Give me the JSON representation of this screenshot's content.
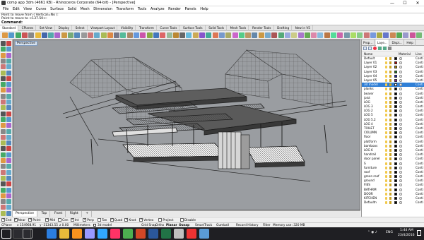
{
  "window": {
    "title": "comp app 3dm (4661 KB) - Rhinoceros Corporate (64-bit) - [Perspective]",
    "minimize": "—",
    "maximize": "☐",
    "close": "✕"
  },
  "menu": [
    "File",
    "Edit",
    "View",
    "Curve",
    "Surface",
    "Solid",
    "Mesh",
    "Dimension",
    "Transform",
    "Tools",
    "Analyze",
    "Render",
    "Panels",
    "Help"
  ],
  "command": {
    "history": [
      "Point to move from ( Vertical=No ):",
      "Point to move to <137.50>:"
    ],
    "prompt": "Command:"
  },
  "toolbar_tabs": [
    "Standard",
    "CPlanes",
    "Set View",
    "Display",
    "Select",
    "Viewport Layout",
    "Visibility",
    "Transform",
    "Curve Tools",
    "Surface Tools",
    "Solid Tools",
    "Mesh Tools",
    "Render Tools",
    "Drafting",
    "New in V5"
  ],
  "toolbar_tabs_active": 0,
  "viewport": {
    "label": "Perspective"
  },
  "view_tabs": [
    "Perspective",
    "Top",
    "Front",
    "Right",
    "+"
  ],
  "view_tabs_active": 0,
  "osnaps": [
    {
      "label": "End",
      "on": true
    },
    {
      "label": "Near",
      "on": true
    },
    {
      "label": "Point",
      "on": true
    },
    {
      "label": "Mid",
      "on": true
    },
    {
      "label": "Cen",
      "on": false
    },
    {
      "label": "Int",
      "on": true
    },
    {
      "label": "Perp",
      "on": true
    },
    {
      "label": "Tan",
      "on": false
    },
    {
      "label": "Quad",
      "on": true
    },
    {
      "label": "Knot",
      "on": true
    },
    {
      "label": "Vertex",
      "on": true
    },
    {
      "label": "Project",
      "on": false
    },
    {
      "label": "Disable",
      "on": false
    }
  ],
  "status": {
    "cplane": "CPlane",
    "x": "x 154968.91",
    "y": "y -31343.55",
    "z": "z 0.00",
    "units": "Millimeters",
    "layer": "3d model",
    "grid_snap": "Grid Snap",
    "ortho": "Ortho",
    "planar": "Planar",
    "osnap": "Osnap",
    "smarttrack": "SmartTrack",
    "gumball": "Gumball",
    "record_history": "Record History",
    "filter": "Filter",
    "memory": "Memory use: 320 MB"
  },
  "panel": {
    "tabs": [
      "Prop...",
      "Laye...",
      "Displ...",
      "Help"
    ],
    "active_tab": 1,
    "col_name": "Name",
    "col_material": "Material",
    "col_linetype": "Line",
    "layers": [
      {
        "name": "Default",
        "color": "#000000"
      },
      {
        "name": "Layer 01",
        "color": "#b00000"
      },
      {
        "name": "Layer 02",
        "color": "#b08a00"
      },
      {
        "name": "Layer 03",
        "color": "#1a7a1a"
      },
      {
        "name": "Layer 04",
        "color": "#1a1aa8"
      },
      {
        "name": "Layer 05",
        "color": "#8a1a8a"
      },
      {
        "name": "3d model",
        "color": "#ffffff",
        "selected": true
      },
      {
        "name": "planks",
        "color": "#000000"
      },
      {
        "name": "bearer",
        "color": "#000000"
      },
      {
        "name": "joist",
        "color": "#000000"
      },
      {
        "name": "LOG",
        "color": "#000000"
      },
      {
        "name": "LOG 3",
        "color": "#000000"
      },
      {
        "name": "LOG 2",
        "color": "#000000"
      },
      {
        "name": "LOG 5",
        "color": "#000000"
      },
      {
        "name": "LOG 5.2",
        "color": "#000000"
      },
      {
        "name": "LOG 4",
        "color": "#000000"
      },
      {
        "name": "TOILET",
        "color": "#000000"
      },
      {
        "name": "COLUMN",
        "color": "#000000"
      },
      {
        "name": "floor",
        "color": "#000000"
      },
      {
        "name": "platform",
        "color": "#000000"
      },
      {
        "name": "bamboos",
        "color": "#000000"
      },
      {
        "name": "LOG 6",
        "color": "#000000"
      },
      {
        "name": "handrail",
        "color": "#000000"
      },
      {
        "name": "door panel",
        "color": "#000000"
      },
      {
        "name": "S",
        "color": "#000000"
      },
      {
        "name": "furniture",
        "color": "#000000"
      },
      {
        "name": "roof",
        "color": "#000000"
      },
      {
        "name": "green roof",
        "color": "#000000"
      },
      {
        "name": "ground",
        "color": "#000000"
      },
      {
        "name": "FIES",
        "color": "#000000"
      },
      {
        "name": "BATHRM",
        "color": "#000000"
      },
      {
        "name": "DOOR",
        "color": "#000000"
      },
      {
        "name": "KITCHEN",
        "color": "#000000"
      },
      {
        "name": "Defaultn",
        "color": "#000000"
      }
    ],
    "linetype": "Conti"
  },
  "taskbar": {
    "time": "1:44 AM",
    "date": "23/4/2016",
    "lang": "ENG",
    "apps": [
      {
        "icon": "windows-logo-icon",
        "color": "#ffffff"
      },
      {
        "icon": "search-icon",
        "color": "#ffffff"
      },
      {
        "icon": "task-view-icon",
        "color": "#ffffff"
      },
      {
        "icon": "edge-icon",
        "color": "#2b7ee0"
      },
      {
        "icon": "file-explorer-icon",
        "color": "#e8b93a"
      },
      {
        "icon": "illustrator-icon",
        "color": "#f7931e"
      },
      {
        "icon": "premiere-icon",
        "color": "#9999ff"
      },
      {
        "icon": "photoshop-icon",
        "color": "#31a8ff"
      },
      {
        "icon": "indesign-icon",
        "color": "#ff3366"
      },
      {
        "icon": "chrome-icon",
        "color": "#4caf50"
      },
      {
        "icon": "powerpoint-icon",
        "color": "#d24726"
      },
      {
        "icon": "word-icon",
        "color": "#2b579a"
      },
      {
        "icon": "excel-icon",
        "color": "#217346"
      },
      {
        "icon": "rhino-icon",
        "color": "#c0c0c0"
      },
      {
        "icon": "sketchup-icon",
        "color": "#e33"
      },
      {
        "icon": "photos-icon",
        "color": "#5a9bd5"
      }
    ]
  }
}
